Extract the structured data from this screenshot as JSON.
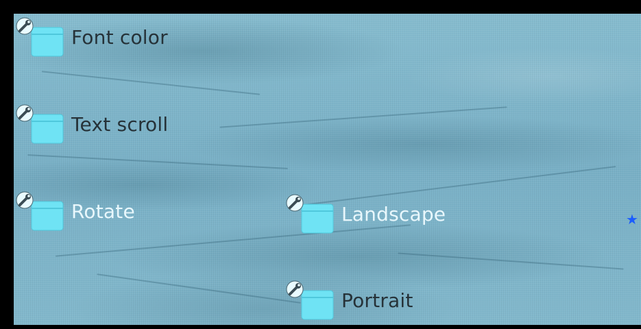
{
  "menu": {
    "items": [
      {
        "label": "Font color",
        "icon": "settings-folder-icon",
        "state": "normal"
      },
      {
        "label": "Text scroll",
        "icon": "settings-folder-icon",
        "state": "normal"
      },
      {
        "label": "Rotate",
        "icon": "settings-folder-icon",
        "state": "highlighted"
      },
      {
        "label": "Landscape",
        "icon": "settings-folder-icon",
        "state": "highlighted"
      },
      {
        "label": "Portrait",
        "icon": "settings-folder-icon",
        "state": "normal"
      }
    ],
    "selection_marker": "★"
  },
  "colors": {
    "icon_fill": "#6fe3f4",
    "label_normal": "#263238",
    "label_highlighted": "#e8f7fc",
    "marker": "#1a5cff",
    "background": "#7fb6cc"
  }
}
